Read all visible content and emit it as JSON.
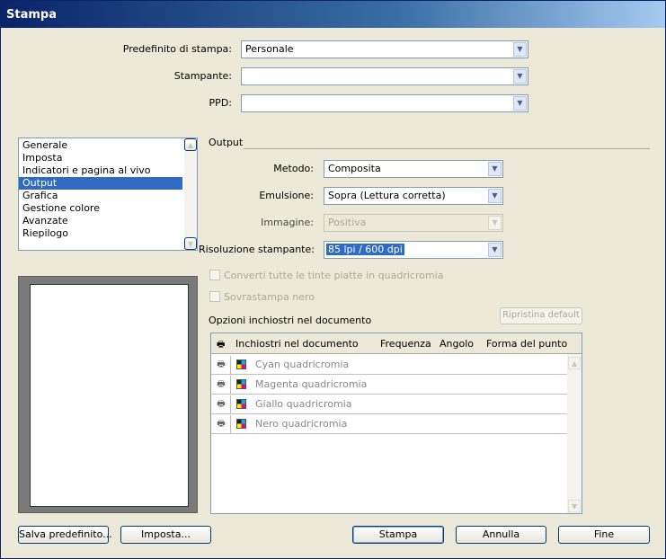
{
  "window": {
    "title": "Stampa"
  },
  "top_fields": {
    "preset": {
      "label": "Predefinito di stampa:",
      "value": "Personale"
    },
    "printer": {
      "label": "Stampante:",
      "value": ""
    },
    "ppd": {
      "label": "PPD:",
      "value": ""
    }
  },
  "sidebar": {
    "items": [
      {
        "label": "Generale",
        "active": false
      },
      {
        "label": "Imposta",
        "active": false
      },
      {
        "label": "Indicatori e pagina al vivo",
        "active": false
      },
      {
        "label": "Output",
        "active": true
      },
      {
        "label": "Grafica",
        "active": false
      },
      {
        "label": "Gestione colore",
        "active": false
      },
      {
        "label": "Avanzate",
        "active": false
      },
      {
        "label": "Riepilogo",
        "active": false
      }
    ]
  },
  "output": {
    "section_title": "Output",
    "method": {
      "label": "Metodo:",
      "value": "Composita"
    },
    "emulsion": {
      "label": "Emulsione:",
      "value": "Sopra (Lettura corretta)"
    },
    "image": {
      "label": "Immagine:",
      "value": "Positiva",
      "enabled": false
    },
    "resolution": {
      "label": "Risoluzione stampante:",
      "value": "85 lpi / 600 dpi"
    },
    "convert_spot": {
      "label": "Converti tutte le tinte piatte in quadricromia",
      "checked": false,
      "enabled": false
    },
    "overprint_black": {
      "label": "Sovrastampa nero",
      "checked": false,
      "enabled": false
    },
    "inks_title": "Opzioni inchiostri nel documento",
    "reset_button": "Ripristina default"
  },
  "ink_table": {
    "columns": [
      "Inchiostri nel documento",
      "Frequenza",
      "Angolo",
      "Forma del punto"
    ],
    "rows": [
      {
        "name": "Cyan quadricromia"
      },
      {
        "name": "Magenta quadricromia"
      },
      {
        "name": "Giallo quadricromia"
      },
      {
        "name": "Nero quadricromia"
      }
    ]
  },
  "buttons": {
    "save_preset": "Salva predefinito...",
    "setup": "Imposta...",
    "print": "Stampa",
    "cancel": "Annulla",
    "done": "Fine"
  },
  "colors": {
    "titlebar": "#0a246a",
    "selection": "#316ac5",
    "face": "#ece9d8"
  }
}
